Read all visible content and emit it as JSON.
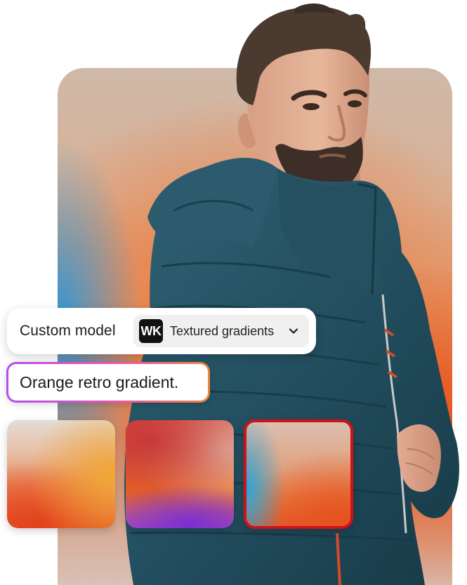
{
  "model_bar": {
    "label": "Custom model",
    "badge": "WK",
    "selected_model": "Textured gradients",
    "dropdown_icon": "chevron-down-icon"
  },
  "prompt": {
    "value": "Orange retro gradient."
  },
  "results": {
    "items": [
      {
        "name": "gradient-result-1",
        "selected": false
      },
      {
        "name": "gradient-result-2",
        "selected": false
      },
      {
        "name": "gradient-result-3",
        "selected": true
      }
    ],
    "selected_border_color": "#d1101a"
  },
  "colors": {
    "prompt_border_start": "#b64cf0",
    "prompt_border_end": "#f0843c",
    "badge_bg": "#111111"
  }
}
